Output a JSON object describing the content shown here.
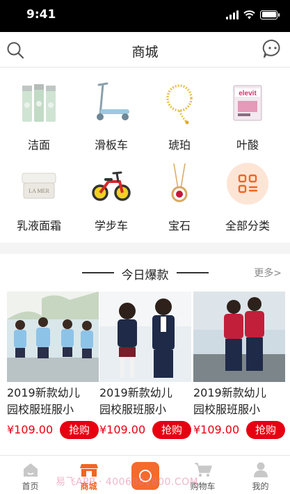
{
  "status_bar": {
    "time": "9:41"
  },
  "header": {
    "title": "商城",
    "search_icon": "search-icon",
    "chat_icon": "chat-bubble-icon"
  },
  "categories": [
    {
      "label": "洁面",
      "icon": "cleanser-bottles"
    },
    {
      "label": "滑板车",
      "icon": "scooter"
    },
    {
      "label": "琥珀",
      "icon": "amber-necklace"
    },
    {
      "label": "叶酸",
      "icon": "folic-acid-box"
    },
    {
      "label": "乳液面霜",
      "icon": "cream-jar"
    },
    {
      "label": "学步车",
      "icon": "balance-bike"
    },
    {
      "label": "宝石",
      "icon": "gem-pendant"
    },
    {
      "label": "全部分类",
      "icon": "grid-category-icon"
    }
  ],
  "hot": {
    "title": "今日爆款",
    "more": "更多>",
    "products": [
      {
        "name_line1": "2019新款幼儿",
        "name_line2": "园校服班服小",
        "price": "¥109.00",
        "buy": "抢购"
      },
      {
        "name_line1": "2019新款幼儿",
        "name_line2": "园校服班服小",
        "price": "¥109.00",
        "buy": "抢购"
      },
      {
        "name_line1": "2019新款幼儿",
        "name_line2": "园校服班服小",
        "price": "¥109.00",
        "buy": "抢购"
      }
    ]
  },
  "tabs": [
    {
      "label": "首页",
      "icon": "home-icon"
    },
    {
      "label": "商城",
      "icon": "store-icon",
      "active": true
    },
    {
      "label": "购物车",
      "icon": "cart-icon"
    },
    {
      "label": "我的",
      "icon": "user-icon"
    }
  ],
  "watermark": "易飞APP · 4006881800.COM",
  "colors": {
    "accent": "#f26522",
    "price": "#e60012",
    "buy_button": "#e60012"
  }
}
